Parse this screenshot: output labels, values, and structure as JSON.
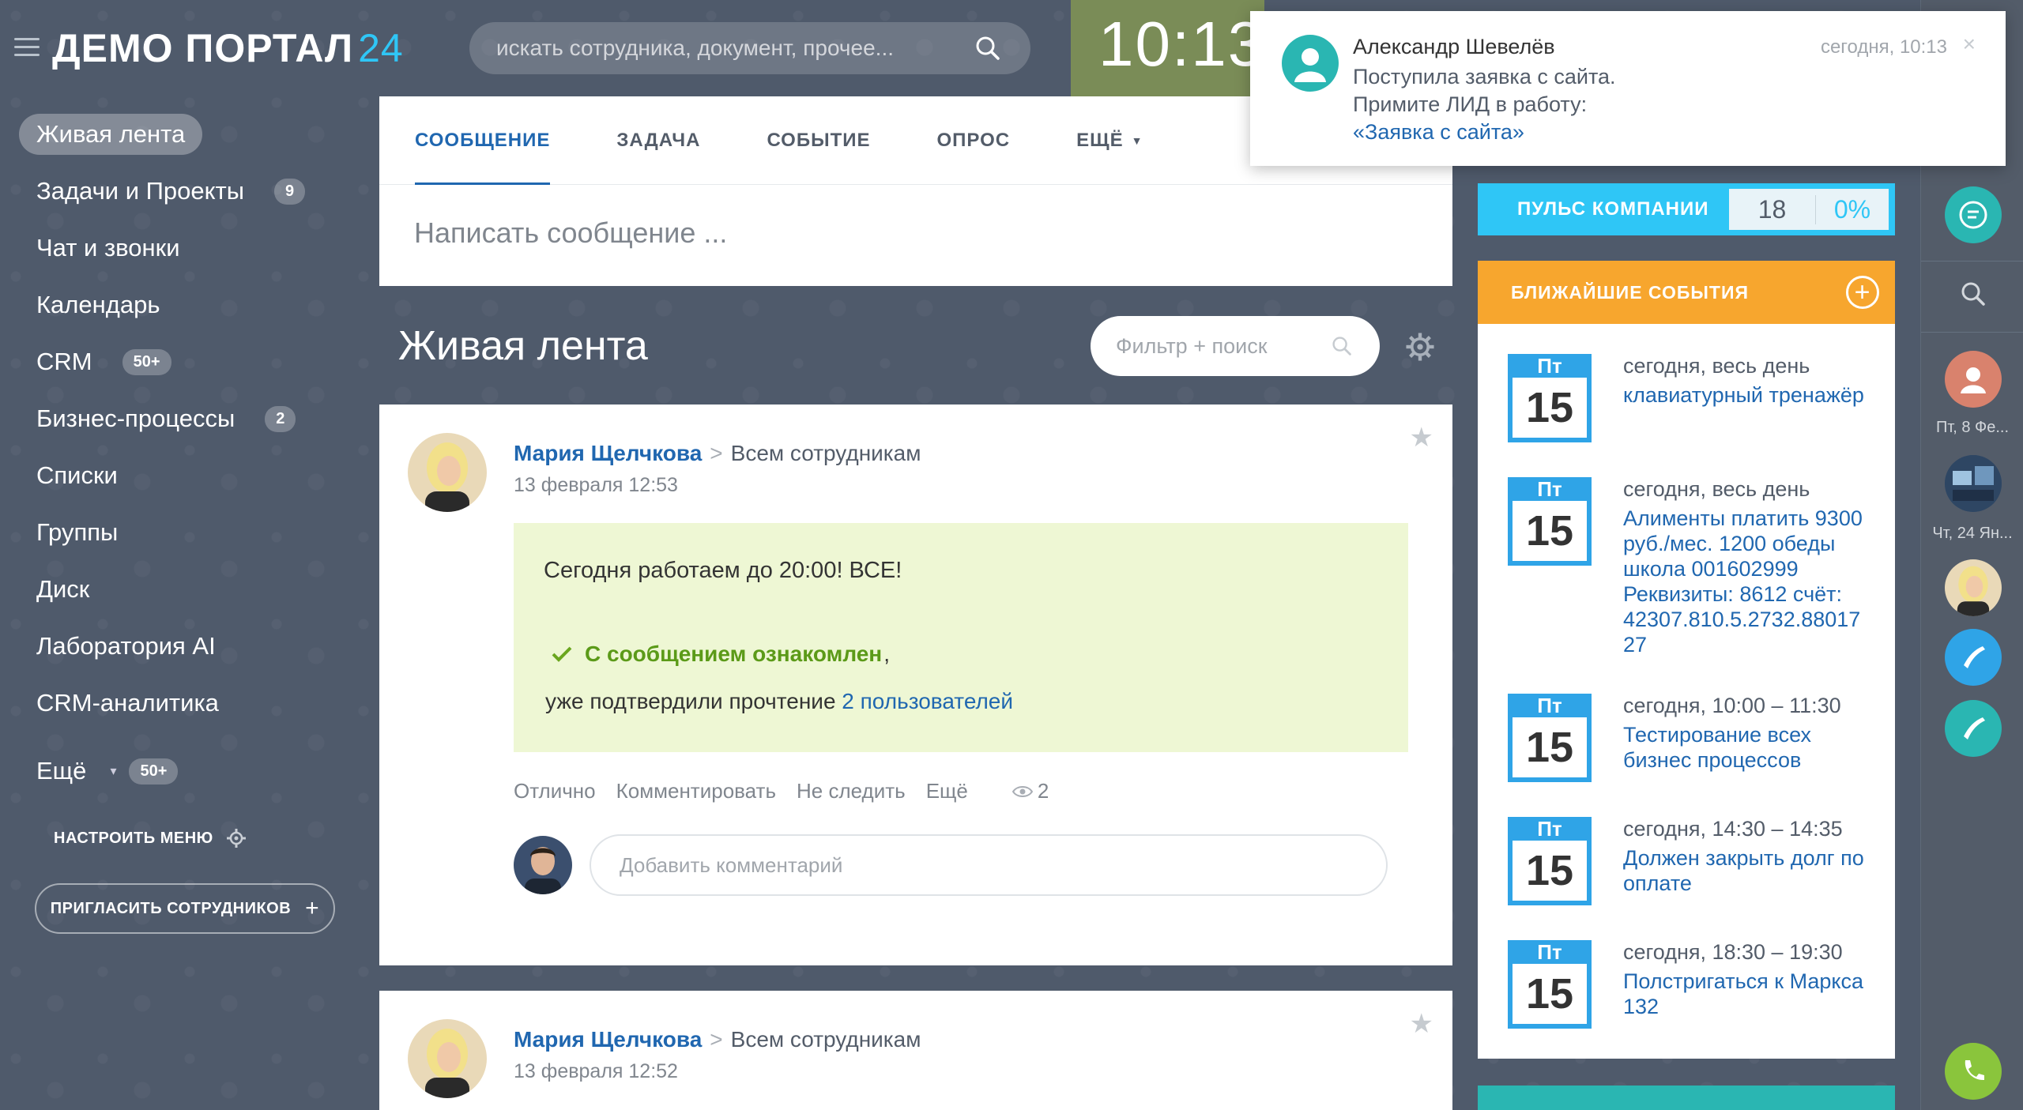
{
  "header": {
    "logo_text": "ДЕМО ПОРТАЛ",
    "logo_num": "24",
    "search_placeholder": "искать сотрудника, документ, прочее...",
    "clock": "10:13"
  },
  "sidebar": {
    "items": [
      {
        "label": "Живая лента",
        "badge": ""
      },
      {
        "label": "Задачи и Проекты",
        "badge": "9"
      },
      {
        "label": "Чат и звонки",
        "badge": ""
      },
      {
        "label": "Календарь",
        "badge": ""
      },
      {
        "label": "CRM",
        "badge": "50+"
      },
      {
        "label": "Бизнес-процессы",
        "badge": "2"
      },
      {
        "label": "Списки",
        "badge": ""
      },
      {
        "label": "Группы",
        "badge": ""
      },
      {
        "label": "Диск",
        "badge": ""
      },
      {
        "label": "Лаборатория AI",
        "badge": ""
      },
      {
        "label": "CRM-аналитика",
        "badge": ""
      },
      {
        "label": "Ещё",
        "badge": "50+"
      }
    ],
    "customize_label": "НАСТРОИТЬ МЕНЮ",
    "invite_label": "ПРИГЛАСИТЬ СОТРУДНИКОВ"
  },
  "composer": {
    "tabs": [
      "СООБЩЕНИЕ",
      "ЗАДАЧА",
      "СОБЫТИЕ",
      "ОПРОС",
      "ЕЩЁ"
    ],
    "placeholder": "Написать сообщение ..."
  },
  "feed": {
    "title": "Живая лента",
    "filter_placeholder": "Фильтр + поиск"
  },
  "posts": [
    {
      "author": "Мария Щелчкова",
      "destination": "Всем сотрудникам",
      "date": "13 февраля 12:53",
      "message": "Сегодня работаем до 20:00! ВСЕ!",
      "ack_text": "С сообщением ознакомлен",
      "read_prefix": "уже подтвердили прочтение",
      "read_link": "2 пользователей",
      "actions": [
        "Отлично",
        "Комментировать",
        "Не следить",
        "Ещё"
      ],
      "views": "2",
      "comment_placeholder": "Добавить комментарий"
    },
    {
      "author": "Мария Щелчкова",
      "destination": "Всем сотрудникам",
      "date": "13 февраля 12:52"
    }
  ],
  "pulse": {
    "label": "ПУЛЬС КОМПАНИИ",
    "count": "18",
    "percent": "0%"
  },
  "events": {
    "title": "БЛИЖАЙШИЕ СОБЫТИЯ",
    "items": [
      {
        "dow": "Пт",
        "day": "15",
        "time": "сегодня, весь день",
        "title": "клавиатурный тренажёр"
      },
      {
        "dow": "Пт",
        "day": "15",
        "time": "сегодня, весь день",
        "title": "Алименты платить 9300 руб./мес. 1200 обеды школа 001602999 Реквизиты: 8612 счёт: 42307.810.5.2732.88017 27"
      },
      {
        "dow": "Пт",
        "day": "15",
        "time": "сегодня, 10:00 – 11:30",
        "title": "Тестирование всех бизнес процессов"
      },
      {
        "dow": "Пт",
        "day": "15",
        "time": "сегодня, 14:30 – 14:35",
        "title": "Должен закрыть долг по оплате"
      },
      {
        "dow": "Пт",
        "day": "15",
        "time": "сегодня, 18:30 – 19:30",
        "title": "Полстригаться к Маркса 132"
      }
    ]
  },
  "right_bar": {
    "captions": [
      "Пт, 8 Фе...",
      "Чт, 24 Ян..."
    ]
  },
  "notification": {
    "name": "Александр Шевелёв",
    "time": "сегодня, 10:13",
    "line1": "Поступила заявка с сайта.",
    "line2": "Примите ЛИД в работу:",
    "link": "«Заявка с сайта»"
  },
  "colors": {
    "accent_blue": "#2067b0",
    "pulse_cyan": "#2fc6f6",
    "events_orange": "#f7a62e",
    "teal": "#2ab6b2",
    "call_green": "#8ac53c"
  }
}
